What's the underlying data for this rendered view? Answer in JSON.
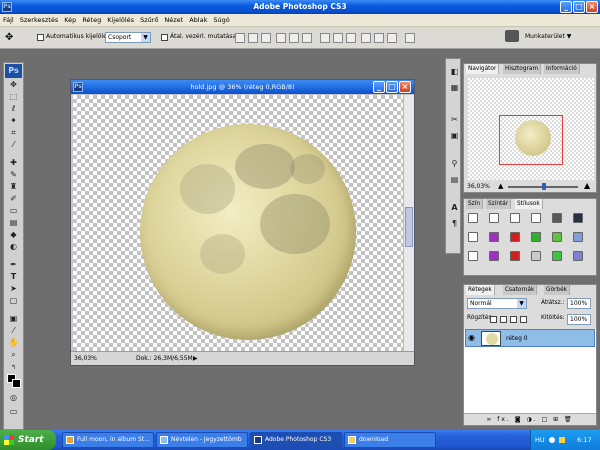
{
  "app": {
    "title": "Adobe Photoshop CS3",
    "logo": "Ps"
  },
  "window_buttons": {
    "minimize": "_",
    "maximize": "□",
    "close": "×"
  },
  "menu": [
    "Fájl",
    "Szerkesztés",
    "Kép",
    "Réteg",
    "Kijelölés",
    "Szűrő",
    "Nézet",
    "Ablak",
    "Súgó"
  ],
  "options_bar": {
    "auto_select_label": "Automatikus kijelölés:",
    "auto_select_value": "Csoport",
    "show_transform_label": "Átal. vezérl. mutatása",
    "workspace_label": "Munkaterület ▼"
  },
  "document": {
    "title": "hold.jpg @ 36% (réteg 0,RGB/8)",
    "zoom": "36,03%",
    "doc_info": "Dok.: 26,3M/6,55M"
  },
  "navigator": {
    "tabs": [
      "Navigátor",
      "Hisztogram",
      "Információ"
    ],
    "zoom": "36,03%"
  },
  "styles_panel": {
    "tabs": [
      "Szín",
      "Színtár",
      "Stílusok"
    ],
    "swatches": [
      "#ffffff",
      "#ffffff",
      "#ffffff",
      "#ffffff",
      "#5a5a5a",
      "#283040",
      "#ffffff",
      "#a030c0",
      "#d02020",
      "#30b030",
      "#60c040",
      "#80a0d8",
      "#ffffff",
      "#a030c0",
      "#d02020",
      "#c8c8c8",
      "#40c040",
      "#8080d0"
    ]
  },
  "layers_panel": {
    "tabs": [
      "Rétegek",
      "Csatornák",
      "Görbék"
    ],
    "blend_mode": "Normál",
    "opacity_label": "Átlátsz.:",
    "opacity_value": "100%",
    "lock_label": "Rögzítés:",
    "fill_label": "Kitöltés:",
    "fill_value": "100%",
    "layers": [
      {
        "name": "réteg 0"
      }
    ],
    "bottom_icons": "∞ fx. ◙ ◑. □ ⊞ 🗑"
  },
  "taskbar": {
    "start": "Start",
    "tasks": [
      "Full moon, in album St...",
      "Névtelen - Jegyzettömb",
      "Adobe Photoshop CS3",
      "download"
    ],
    "lang": "HU",
    "clock": "6:17"
  },
  "colors": {
    "accent": "#0a50d0",
    "taskbar": "#2460d8",
    "moon": "#e2daa4"
  }
}
